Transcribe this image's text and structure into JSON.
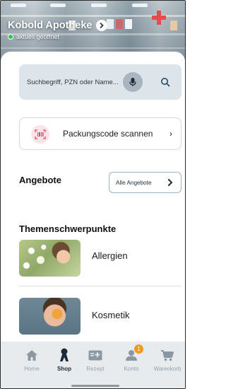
{
  "header": {
    "store_name": "Kobold Apotheke",
    "status": "aktuell geöffnet",
    "status_color": "#28c840"
  },
  "search": {
    "placeholder": "Suchbegriff, PZN oder Name...",
    "mic_icon": "microphone-icon",
    "search_icon": "search-icon"
  },
  "scan": {
    "label": "Packungscode scannen",
    "arrow": "›",
    "icon": "barcode-scan-icon"
  },
  "offers": {
    "heading": "Angebote",
    "all_button_label": "Alle Angebote"
  },
  "topics": {
    "heading": "Themenschwerpunkte",
    "items": [
      {
        "label": "Allergien"
      },
      {
        "label": "Kosmetik"
      }
    ]
  },
  "nav": {
    "items": [
      {
        "label": "Home",
        "icon": "home-icon",
        "active": false
      },
      {
        "label": "Shop",
        "icon": "shop-icon",
        "active": true
      },
      {
        "label": "Rezept",
        "icon": "prescription-icon",
        "active": false
      },
      {
        "label": "Konto",
        "icon": "account-icon",
        "active": false,
        "badge": "1"
      },
      {
        "label": "Warenkorb",
        "icon": "cart-icon",
        "active": false
      }
    ]
  },
  "colors": {
    "accent": "#1b2a36",
    "badge": "#f29a1f",
    "scan_icon_bg": "#fbe3e7",
    "scan_icon_fg": "#d9466a",
    "search_bg": "#dde4ea"
  }
}
